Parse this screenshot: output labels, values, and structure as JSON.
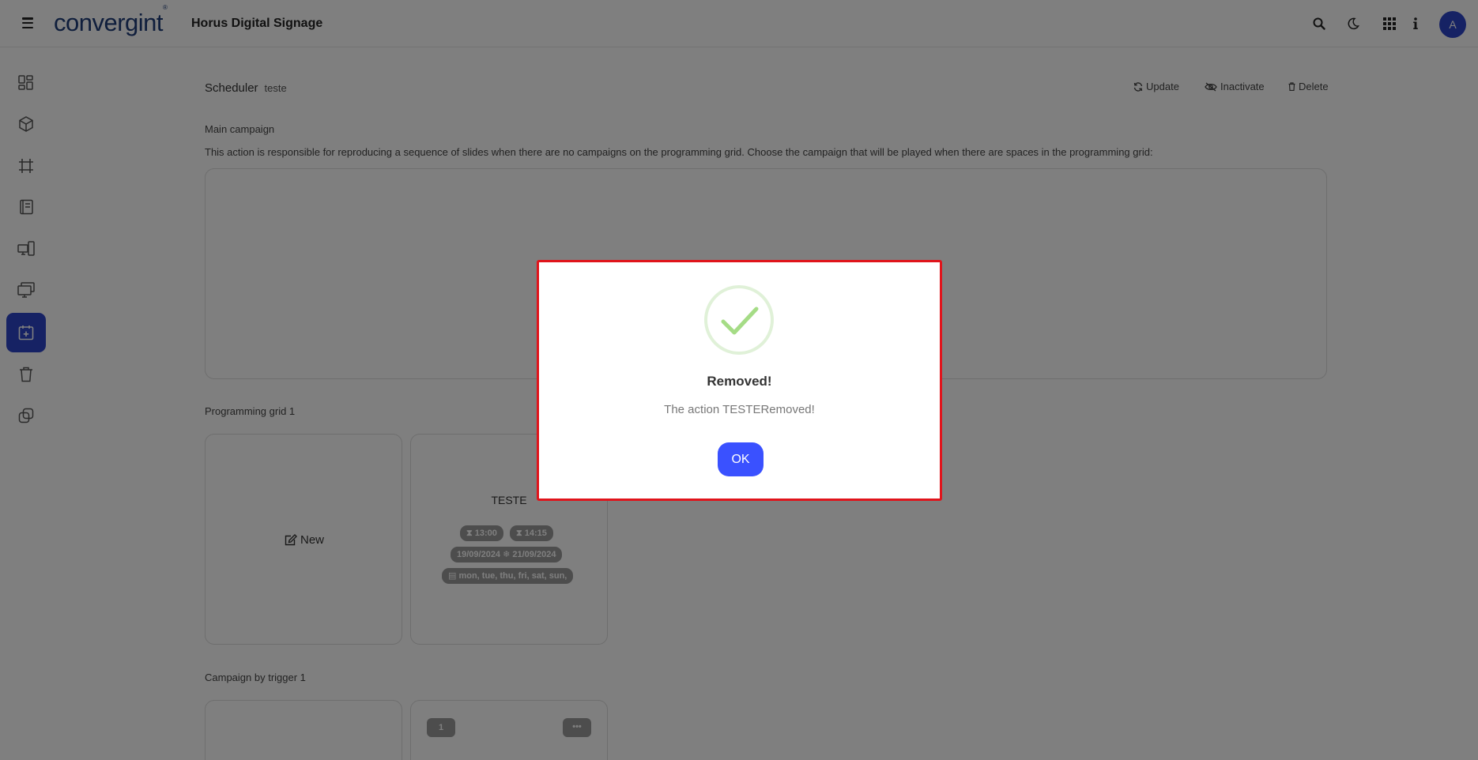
{
  "header": {
    "logo": "convergint",
    "logo_mark": "®",
    "app_title": "Horus Digital Signage",
    "avatar_initial": "A"
  },
  "page": {
    "title": "Scheduler",
    "subtitle": "teste",
    "actions": {
      "update": "Update",
      "inactivate": "Inactivate",
      "delete": "Delete"
    }
  },
  "main_campaign": {
    "title": "Main campaign",
    "description": "This action is responsible for reproducing a sequence of slides when there are no campaigns on the programming grid. Choose the campaign that will be played when there are spaces in the programming grid:"
  },
  "programming_grid": {
    "title": "Programming grid 1",
    "new_label": "New",
    "card": {
      "name": "TESTE",
      "start_time": "13:00",
      "end_time": "14:15",
      "date_range": "19/09/2024 ❄ 21/09/2024",
      "days": "mon, tue, thu, fri, sat, sun,"
    }
  },
  "campaign_trigger": {
    "title": "Campaign by trigger 1",
    "card_number": "1",
    "more_label": "•••"
  },
  "dialog": {
    "title": "Removed!",
    "message": "The action TESTERemoved!",
    "ok_label": "OK"
  },
  "colors": {
    "brand": "#1e3c78",
    "accent": "#2d44c9",
    "ok_button": "#3a51ff",
    "dialog_border": "#e0141b",
    "success": "#a5dc86"
  }
}
